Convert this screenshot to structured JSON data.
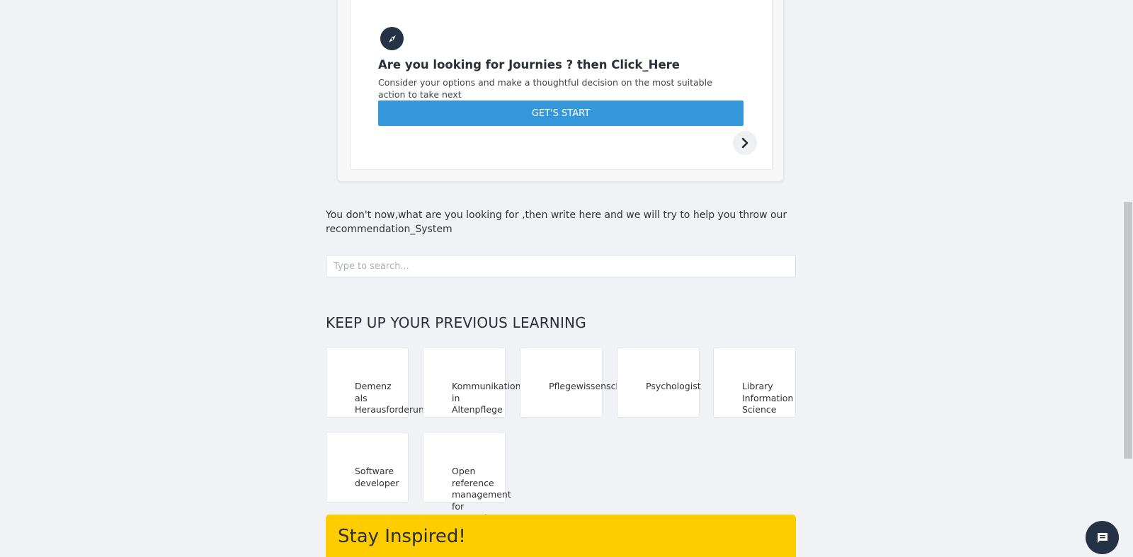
{
  "journey_card": {
    "title": "Are you looking for Journies ? then Click_Here",
    "description": "Consider your options and make a thoughtful decision on the most suitable action to take next",
    "button_label": "GET'S START"
  },
  "recommendation": {
    "prompt": "You don't now,what are you looking for ,then write here and we will try to help you throw our recommendation_System",
    "search_placeholder": "Type to search..."
  },
  "previous_learning": {
    "title": "KEEP UP YOUR PREVIOUS LEARNING",
    "items": [
      {
        "label": "Demenz als Herausforderung"
      },
      {
        "label": "Kommunikation in Altenpflege"
      },
      {
        "label": "Pflegewissenschaft"
      },
      {
        "label": "Psychologist"
      },
      {
        "label": "Library Information Science"
      },
      {
        "label": "Software developer"
      },
      {
        "label": "Open reference management for researchers"
      }
    ]
  },
  "inspire": {
    "title": "Stay Inspired!"
  },
  "colors": {
    "background": "#f0f2f6",
    "primary_button": "#3498db",
    "inspire_banner": "#ffcc00",
    "dark_icon": "#253245"
  },
  "icons": {
    "journey": "compass-icon",
    "next": "chevron-right-icon",
    "chat": "chat-icon"
  }
}
